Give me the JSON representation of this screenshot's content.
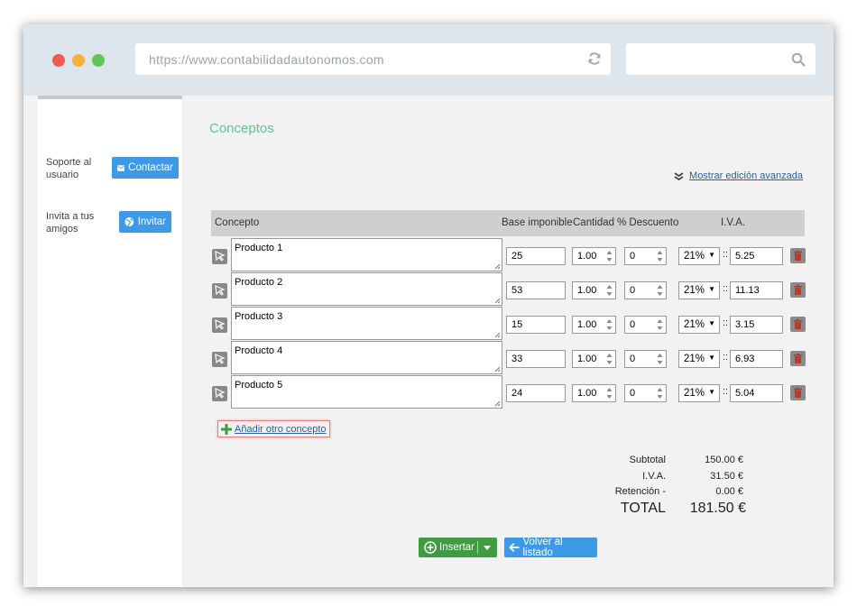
{
  "browser": {
    "url": "https://www.contabilidadautonomos.com",
    "search_value": ""
  },
  "sidebar": {
    "support_label": "Soporte al usuario",
    "support_line1": "Soporte al",
    "support_line2": "usuario",
    "contact_button": "Contactar",
    "invite_line1": "Invita a tus",
    "invite_line2": "amigos",
    "invite_button": "Invitar"
  },
  "main": {
    "title": "Conceptos",
    "advanced_link": "Mostrar edición avanzada",
    "columns": {
      "concepto": "Concepto",
      "base": "Base imponible",
      "cantidad": "Cantidad",
      "descuento": "% Descuento",
      "iva": "I.V.A."
    },
    "rows": [
      {
        "concept": "Producto 1",
        "base": "25",
        "qty": "1.00",
        "discount": "0",
        "vat_rate": "21%",
        "vat_amount": "5.25"
      },
      {
        "concept": "Producto 2",
        "base": "53",
        "qty": "1.00",
        "discount": "0",
        "vat_rate": "21%",
        "vat_amount": "11.13"
      },
      {
        "concept": "Producto 3",
        "base": "15",
        "qty": "1.00",
        "discount": "0",
        "vat_rate": "21%",
        "vat_amount": "3.15"
      },
      {
        "concept": "Producto 4",
        "base": "33",
        "qty": "1.00",
        "discount": "0",
        "vat_rate": "21%",
        "vat_amount": "6.93"
      },
      {
        "concept": "Producto 5",
        "base": "24",
        "qty": "1.00",
        "discount": "0",
        "vat_rate": "21%",
        "vat_amount": "5.04"
      }
    ],
    "separator": "::",
    "add_concept": "Añadir otro concepto",
    "totals": {
      "subtotal_label": "Subtotal",
      "subtotal": "150.00 €",
      "iva_label": "I.V.A.",
      "iva": "31.50 €",
      "retencion_label": "Retención -",
      "retencion": "0.00 €",
      "total_label": "TOTAL",
      "total": "181.50 €"
    },
    "insert_button": "Insertar",
    "back_button": "Volver al listado"
  },
  "colors": {
    "accent_green": "#5bc98f",
    "button_blue": "#3e9ae8",
    "button_green": "#3f9c40",
    "trash_red": "#c0392b"
  }
}
